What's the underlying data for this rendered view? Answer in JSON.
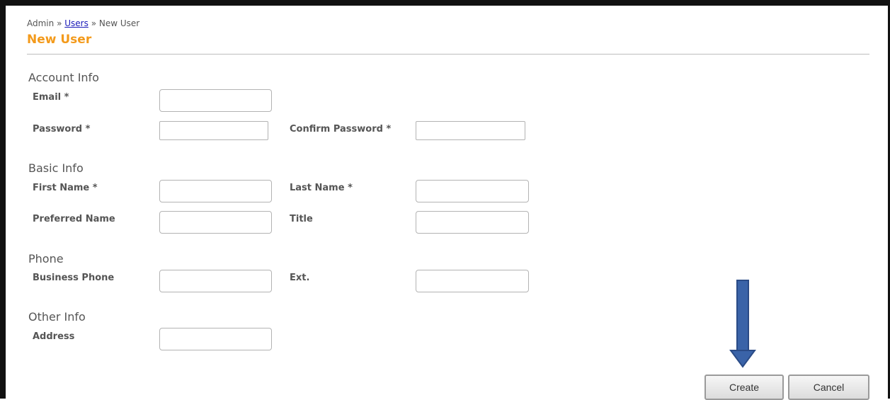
{
  "breadcrumb": {
    "root": "Admin",
    "sep": "»",
    "link": "Users",
    "current": "New User"
  },
  "page_title": "New User",
  "sections": {
    "account": "Account Info",
    "basic": "Basic Info",
    "phone": "Phone",
    "other": "Other Info"
  },
  "fields": {
    "email": {
      "label": "Email *",
      "value": ""
    },
    "password": {
      "label": "Password *",
      "value": ""
    },
    "confirm_password": {
      "label": "Confirm Password *",
      "value": ""
    },
    "first_name": {
      "label": "First Name *",
      "value": ""
    },
    "last_name": {
      "label": "Last Name *",
      "value": ""
    },
    "preferred_name": {
      "label": "Preferred Name",
      "value": ""
    },
    "title": {
      "label": "Title",
      "value": ""
    },
    "business_phone": {
      "label": "Business Phone",
      "value": ""
    },
    "ext": {
      "label": "Ext.",
      "value": ""
    },
    "address": {
      "label": "Address",
      "value": ""
    }
  },
  "buttons": {
    "create": "Create",
    "cancel": "Cancel"
  },
  "colors": {
    "title": "#f39a1b",
    "link": "#1a1ab8",
    "arrow": "#3a63a8"
  },
  "icons": {
    "annotation": "down-arrow-icon"
  }
}
